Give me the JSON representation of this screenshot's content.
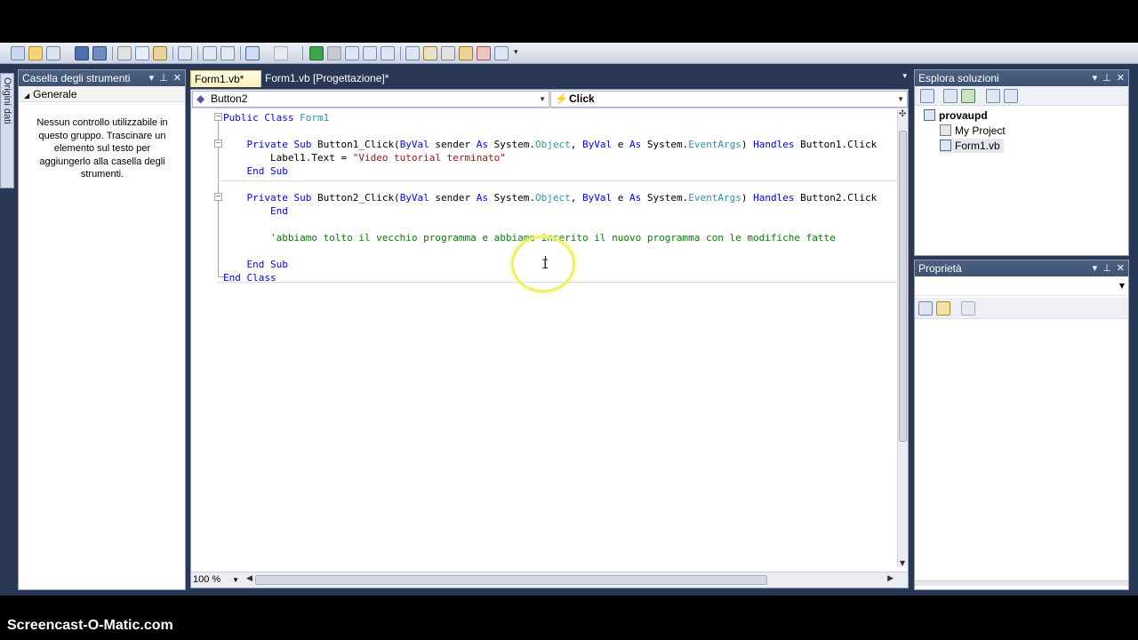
{
  "toolbox": {
    "title": "Casella degli strumenti",
    "group": "Generale",
    "empty_message": "Nessun controllo utilizzabile in questo gruppo. Trascinare un elemento sul testo per aggiungerlo alla casella degli strumenti."
  },
  "side_tab": {
    "label": "Origini dati"
  },
  "tabs": [
    {
      "label": "Form1.vb*"
    },
    {
      "label": "Form1.vb [Progettazione]*"
    }
  ],
  "navbar": {
    "object": "Button2",
    "event": "Click"
  },
  "code": {
    "lines": [
      [
        {
          "t": "Public Class ",
          "c": "kw"
        },
        {
          "t": "Form1",
          "c": "ty"
        }
      ],
      [],
      [
        {
          "t": "    Private Sub ",
          "c": "kw"
        },
        {
          "t": "Button1_Click(",
          "c": ""
        },
        {
          "t": "ByVal",
          "c": "kw"
        },
        {
          "t": " sender ",
          "c": ""
        },
        {
          "t": "As",
          "c": "kw"
        },
        {
          "t": " System.",
          "c": ""
        },
        {
          "t": "Object",
          "c": "ty"
        },
        {
          "t": ", ",
          "c": ""
        },
        {
          "t": "ByVal",
          "c": "kw"
        },
        {
          "t": " e ",
          "c": ""
        },
        {
          "t": "As",
          "c": "kw"
        },
        {
          "t": " System.",
          "c": ""
        },
        {
          "t": "EventArgs",
          "c": "ty"
        },
        {
          "t": ") ",
          "c": ""
        },
        {
          "t": "Handles",
          "c": "kw"
        },
        {
          "t": " Button1.Click",
          "c": ""
        }
      ],
      [
        {
          "t": "        Label1.Text = ",
          "c": ""
        },
        {
          "t": "\"Video tutorial terminato\"",
          "c": "str"
        }
      ],
      [
        {
          "t": "    End Sub",
          "c": "kw"
        }
      ],
      [],
      [
        {
          "t": "    Private Sub ",
          "c": "kw"
        },
        {
          "t": "Button2_Click(",
          "c": ""
        },
        {
          "t": "ByVal",
          "c": "kw"
        },
        {
          "t": " sender ",
          "c": ""
        },
        {
          "t": "As",
          "c": "kw"
        },
        {
          "t": " System.",
          "c": ""
        },
        {
          "t": "Object",
          "c": "ty"
        },
        {
          "t": ", ",
          "c": ""
        },
        {
          "t": "ByVal",
          "c": "kw"
        },
        {
          "t": " e ",
          "c": ""
        },
        {
          "t": "As",
          "c": "kw"
        },
        {
          "t": " System.",
          "c": ""
        },
        {
          "t": "EventArgs",
          "c": "ty"
        },
        {
          "t": ") ",
          "c": ""
        },
        {
          "t": "Handles",
          "c": "kw"
        },
        {
          "t": " Button2.Click",
          "c": ""
        }
      ],
      [
        {
          "t": "        End",
          "c": "kw"
        }
      ],
      [],
      [
        {
          "t": "        'abbiamo tolto il vecchio programma e abbiamo inserito il nuovo programma con le modifiche fatte",
          "c": "cm"
        }
      ],
      [],
      [
        {
          "t": "    End Sub",
          "c": "kw"
        }
      ],
      [
        {
          "t": "End Class",
          "c": "kw"
        }
      ]
    ]
  },
  "zoom": "100 %",
  "solution_explorer": {
    "title": "Esplora soluzioni",
    "items": [
      {
        "label": "provaupd",
        "bold": true
      },
      {
        "label": "My Project"
      },
      {
        "label": "Form1.vb"
      }
    ]
  },
  "properties": {
    "title": "Proprietà"
  },
  "watermark": "Screencast-O-Matic.com"
}
